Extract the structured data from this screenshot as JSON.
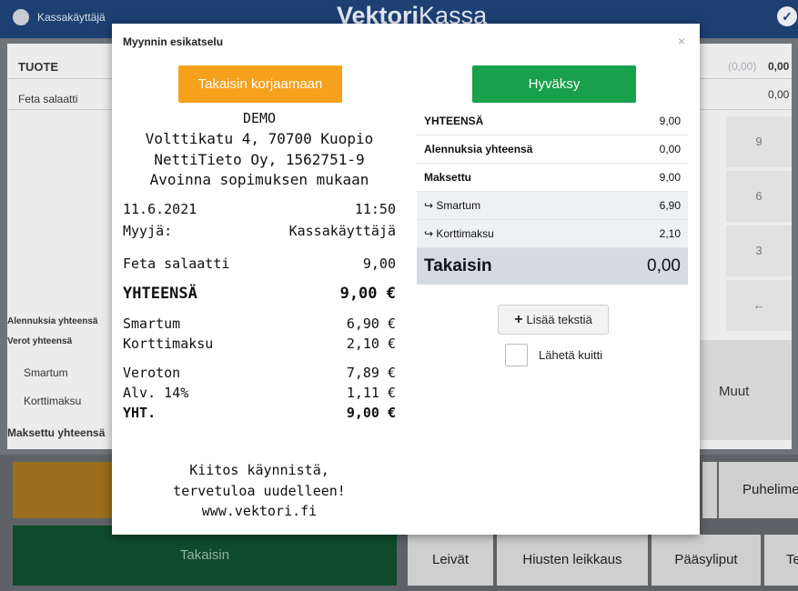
{
  "topbar": {
    "user": "Kassakäyttäjä",
    "brand_bold": "Vektori",
    "brand_light": "Kassa"
  },
  "background": {
    "col_header": "TUOTE",
    "header_right_paren": "(0,00)",
    "header_right_value": "0,00",
    "item_name": "Feta salaatti",
    "item_value": "0,00",
    "discounts_label": "Alennuksia yhteensä",
    "taxes_label": "Verot yhteensä",
    "pay1": "Smartum",
    "pay2": "Korttimaksu",
    "paid_total_label": "Maksettu yhteensä",
    "keys": [
      "9",
      "6",
      "3",
      "←"
    ],
    "muut": "Muut",
    "phone": "Puhelimet",
    "back": "Takaisin",
    "categories": [
      "Leivät",
      "Hiusten leikkaus",
      "Pääsyliput",
      "Te"
    ]
  },
  "modal": {
    "title": "Myynnin esikatselu",
    "close": "×",
    "back_button": "Takaisin korjaamaan",
    "accept_button": "Hyväksy",
    "receipt": {
      "header": [
        "DEMO",
        "Volttikatu 4, 70700 Kuopio",
        "NettiTieto Oy, 1562751-9",
        "Avoinna sopimuksen mukaan"
      ],
      "date": "11.6.2021",
      "time": "11:50",
      "seller_label": "Myyjä:",
      "seller": "Kassakäyttäjä",
      "item": "Feta salaatti",
      "item_price": "9,00",
      "total_label": "YHTEENSÄ",
      "total": "9,00 €",
      "pay1_label": "Smartum",
      "pay1": "6,90 €",
      "pay2_label": "Korttimaksu",
      "pay2": "2,10 €",
      "tax_free_label": "Veroton",
      "tax_free": "7,89 €",
      "vat_label": "Alv. 14%",
      "vat": "1,11 €",
      "grand_label": "YHT.",
      "grand": "9,00 €",
      "footer": [
        "Kiitos käynnistä,",
        "tervetuloa uudelleen!",
        "www.vektori.fi"
      ]
    },
    "summary": [
      {
        "label": "YHTEENSÄ",
        "value": "9,00"
      },
      {
        "label": "Alennuksia yhteensä",
        "value": "0,00"
      },
      {
        "label": "Maksettu",
        "value": "9,00"
      },
      {
        "label": "↪ Smartum",
        "value": "6,90"
      },
      {
        "label": "↪ Korttimaksu",
        "value": "2,10"
      },
      {
        "label": "Takaisin",
        "value": "0,00"
      }
    ],
    "add_text_button": "Lisää tekstiä",
    "send_receipt_label": "Lähetä kuitti"
  },
  "colors": {
    "topbar": "#1d3f72",
    "orange": "#f6a01b",
    "green": "#18a04a",
    "summary_total_bg": "#d5dae3"
  }
}
